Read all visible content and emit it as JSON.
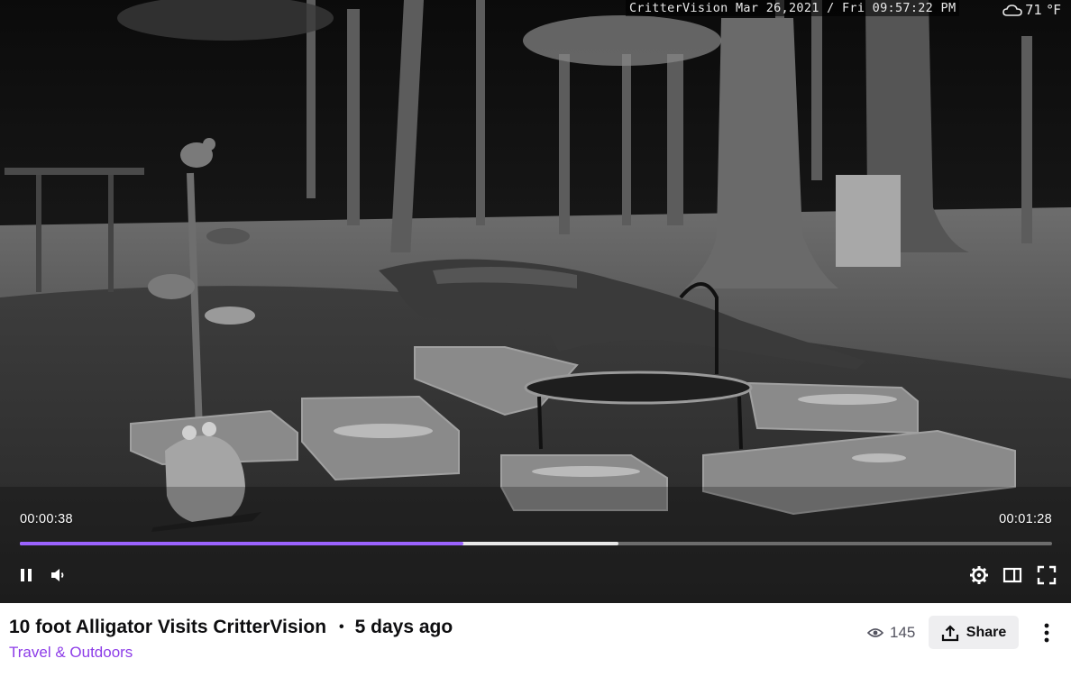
{
  "camera_overlay": {
    "stamp": "CritterVision Mar 26,2021 / Fri 09:57:22 PM",
    "temperature": "71 °F",
    "weather_icon": "cloud-icon"
  },
  "player": {
    "current_time": "00:00:38",
    "total_time": "00:01:28",
    "progress_fraction": 0.43,
    "buffered_fraction": 0.58,
    "accent_color": "#9b63ff",
    "controls": {
      "left": [
        "pause-icon",
        "volume-icon"
      ],
      "right": [
        "settings-icon",
        "theatre-mode-icon",
        "fullscreen-icon"
      ]
    }
  },
  "video_info": {
    "title": "10 foot Alligator Visits CritterVision",
    "separator": "•",
    "age": "5 days ago",
    "category": "Travel & Outdoors",
    "category_color": "#8d3de8",
    "view_count": "145",
    "share_label": "Share"
  }
}
